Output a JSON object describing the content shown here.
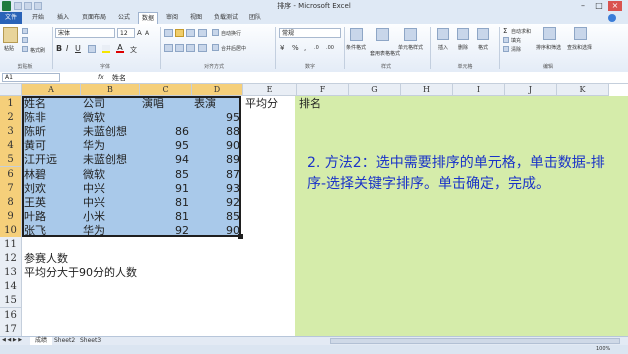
{
  "window": {
    "title": "排序 - Microsoft Excel"
  },
  "tabs": [
    "文件",
    "开始",
    "插入",
    "页面布局",
    "公式",
    "数据",
    "审阅",
    "视图",
    "负载测试",
    "团队"
  ],
  "ribbon": {
    "paste": "粘贴",
    "format_painter": "格式刷",
    "font_name": "宋体",
    "font_size": "12",
    "wrap_text": "自动换行",
    "merge_center": "合并后居中",
    "number_format": "常规",
    "cond_format": "条件格式",
    "table_format": "套用表格格式",
    "cell_style": "单元格样式",
    "insert": "插入",
    "delete": "删除",
    "format": "格式",
    "autosum": "自动求和",
    "fill": "填充",
    "clear": "清除",
    "sort_filter": "排序和筛选",
    "find_select": "查找和选择",
    "groups": [
      "剪贴板",
      "字体",
      "对齐方式",
      "数字",
      "样式",
      "单元格",
      "编辑"
    ]
  },
  "formula_bar": {
    "name_box": "A1",
    "fx": "fx",
    "content": "姓名"
  },
  "columns": [
    "A",
    "B",
    "C",
    "D",
    "E",
    "F",
    "G",
    "H",
    "I",
    "J",
    "K"
  ],
  "rows": [
    [
      "姓名",
      "公司",
      "演唱",
      "表演",
      "平均分",
      "排名"
    ],
    [
      "陈非",
      "微软",
      "",
      "95"
    ],
    [
      "陈昕",
      "未蓝创想",
      "86",
      "88"
    ],
    [
      "黄可",
      "华为",
      "95",
      "90"
    ],
    [
      "江开远",
      "未蓝创想",
      "94",
      "89"
    ],
    [
      "林碧",
      "微软",
      "85",
      "87"
    ],
    [
      "刘欢",
      "中兴",
      "91",
      "93"
    ],
    [
      "王英",
      "中兴",
      "81",
      "92"
    ],
    [
      "叶路",
      "小米",
      "81",
      "85"
    ],
    [
      "张飞",
      "华为",
      "92",
      "90"
    ],
    [],
    [
      "参赛人数"
    ],
    [
      "平均分大于90分的人数"
    ]
  ],
  "row_numbers": [
    "1",
    "2",
    "3",
    "4",
    "5",
    "6",
    "7",
    "8",
    "9",
    "10",
    "11",
    "12",
    "13",
    "14",
    "15",
    "16",
    "17"
  ],
  "annotation": "2. 方法2：选中需要排序的单元格，单击数据-排序-选择关键字排序。单击确定，完成。",
  "sheets": [
    "成绩",
    "Sheet2",
    "Sheet3"
  ],
  "status": {
    "zoom": "100%"
  },
  "colors": {
    "selection": "#a9c9ea",
    "note_bg": "#d5ecaa",
    "note_text": "#1a33c8",
    "sel_header": "#f5cf7a"
  }
}
